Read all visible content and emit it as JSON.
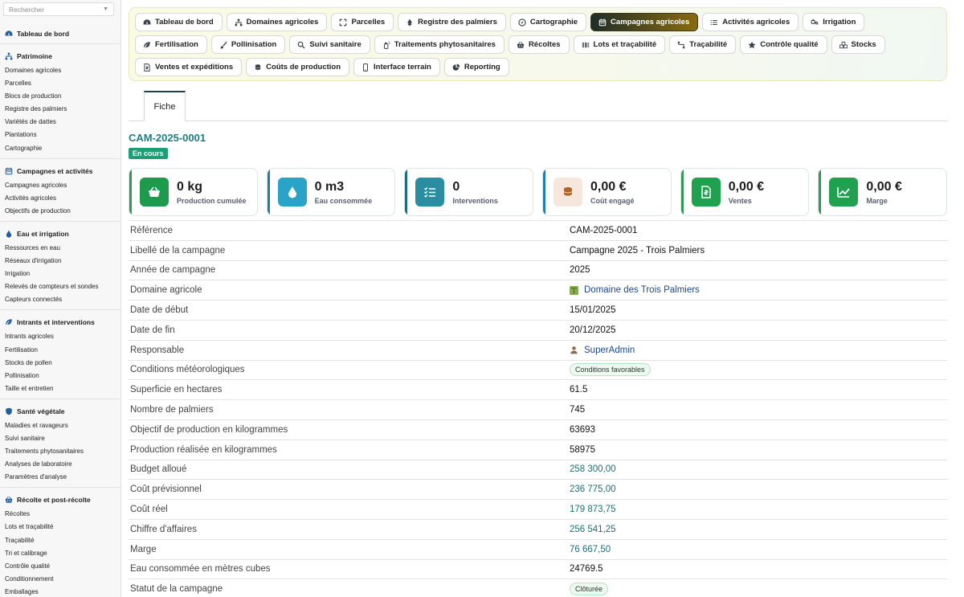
{
  "search": {
    "placeholder": "Rechercher"
  },
  "sidebar": {
    "dashboard_label": "Tableau de bord",
    "groups": [
      {
        "title": "Patrimoine",
        "icon": "sitemap-icon",
        "items": [
          "Domaines agricoles",
          "Parcelles",
          "Blocs de production",
          "Registre des palmiers",
          "Variétés de dattes",
          "Plantations",
          "Cartographie"
        ]
      },
      {
        "title": "Campagnes et activités",
        "icon": "calendar-icon",
        "items": [
          "Campagnes agricoles",
          "Activités agricoles",
          "Objectifs de production"
        ]
      },
      {
        "title": "Eau et irrigation",
        "icon": "droplet-icon",
        "items": [
          "Ressources en eau",
          "Réseaux d'irrigation",
          "Irrigation",
          "Relevés de compteurs et sondes",
          "Capteurs connectés"
        ]
      },
      {
        "title": "Intrants et interventions",
        "icon": "leaf-icon",
        "items": [
          "Intrants agricoles",
          "Fertilisation",
          "Stocks de pollen",
          "Pollinisation",
          "Taille et entretien"
        ]
      },
      {
        "title": "Santé végétale",
        "icon": "shield-icon",
        "items": [
          "Maladies et ravageurs",
          "Suivi sanitaire",
          "Traitements phytosanitaires",
          "Analyses de laboratoire",
          "Paramètres d'analyse"
        ]
      },
      {
        "title": "Récolte et post-récolte",
        "icon": "basket-icon",
        "items": [
          "Récoltes",
          "Lots et traçabilité",
          "Traçabilité",
          "Tri et calibrage",
          "Contrôle qualité",
          "Conditionnement",
          "Emballages"
        ]
      }
    ]
  },
  "nav": [
    {
      "label": "Tableau de bord",
      "icon": "dashboard-icon",
      "active": false
    },
    {
      "label": "Domaines agricoles",
      "icon": "sitemap-icon",
      "active": false
    },
    {
      "label": "Parcelles",
      "icon": "expand-icon",
      "active": false
    },
    {
      "label": "Registre des palmiers",
      "icon": "tree-icon",
      "active": false
    },
    {
      "label": "Cartographie",
      "icon": "compass-icon",
      "active": false
    },
    {
      "label": "Campagnes agricoles",
      "icon": "calendar-icon",
      "active": true
    },
    {
      "label": "Activités agricoles",
      "icon": "list-icon",
      "active": false
    },
    {
      "label": "Irrigation",
      "icon": "faucet-icon",
      "active": false
    },
    {
      "label": "Fertilisation",
      "icon": "leaf-icon",
      "active": false
    },
    {
      "label": "Pollinisation",
      "icon": "brush-icon",
      "active": false
    },
    {
      "label": "Suivi sanitaire",
      "icon": "search-icon",
      "active": false
    },
    {
      "label": "Traitements phytosanitaires",
      "icon": "spray-icon",
      "active": false
    },
    {
      "label": "Récoltes",
      "icon": "basket-icon",
      "active": false
    },
    {
      "label": "Lots et traçabilité",
      "icon": "barcode-icon",
      "active": false
    },
    {
      "label": "Traçabilité",
      "icon": "route-icon",
      "active": false
    },
    {
      "label": "Contrôle qualité",
      "icon": "star-icon",
      "active": false
    },
    {
      "label": "Stocks",
      "icon": "cubes-icon",
      "active": false
    },
    {
      "label": "Ventes et expéditions",
      "icon": "invoice-icon",
      "active": false
    },
    {
      "label": "Coûts de production",
      "icon": "coins-icon",
      "active": false
    },
    {
      "label": "Interface terrain",
      "icon": "mobile-icon",
      "active": false
    },
    {
      "label": "Reporting",
      "icon": "pie-chart-icon",
      "active": false
    }
  ],
  "tab": {
    "label": "Fiche"
  },
  "record": {
    "code": "CAM-2025-0001",
    "status": "En cours"
  },
  "kpis": [
    {
      "value": "0 kg",
      "label": "Production cumulée",
      "icon": "basket-icon",
      "color": "#1e9a4c",
      "bar": "#2e9a55",
      "fg": "#ffffff"
    },
    {
      "value": "0 m3",
      "label": "Eau consommée",
      "icon": "droplet-icon",
      "color": "#2aa3c9",
      "bar": "#1b7fa7",
      "fg": "#ffffff"
    },
    {
      "value": "0",
      "label": "Interventions",
      "icon": "checklist-icon",
      "color": "#2b8ea0",
      "bar": "#1b6e7e",
      "fg": "#ffffff"
    },
    {
      "value": "0,00 €",
      "label": "Coût engagé",
      "icon": "coins-icon",
      "color": "#f6e6dc",
      "bar": "#1b7fa7",
      "fg": "#b0642a"
    },
    {
      "value": "0,00 €",
      "label": "Ventes",
      "icon": "invoice-icon",
      "color": "#1fa150",
      "bar": "#2e9a55",
      "fg": "#ffffff"
    },
    {
      "value": "0,00 €",
      "label": "Marge",
      "icon": "chart-line-icon",
      "color": "#1fa150",
      "bar": "#2e9a55",
      "fg": "#ffffff"
    }
  ],
  "fields": [
    {
      "label": "Référence",
      "value": "CAM-2025-0001",
      "kind": "text"
    },
    {
      "label": "Libellé de la campagne",
      "value": "Campagne 2025 - Trois Palmiers",
      "kind": "text"
    },
    {
      "label": "Année de campagne",
      "value": "2025",
      "kind": "text"
    },
    {
      "label": "Domaine agricole",
      "value": "Domaine des Trois Palmiers",
      "kind": "link",
      "icon": "palm-icon"
    },
    {
      "label": "Date de début",
      "value": "15/01/2025",
      "kind": "text"
    },
    {
      "label": "Date de fin",
      "value": "20/12/2025",
      "kind": "text"
    },
    {
      "label": "Responsable",
      "value": "SuperAdmin",
      "kind": "link",
      "icon": "user-icon"
    },
    {
      "label": "Conditions météorologiques",
      "value": "Conditions favorables",
      "kind": "pill"
    },
    {
      "label": "Superficie en hectares",
      "value": "61.5",
      "kind": "text"
    },
    {
      "label": "Nombre de palmiers",
      "value": "745",
      "kind": "text"
    },
    {
      "label": "Objectif de production en kilogrammes",
      "value": "63693",
      "kind": "text"
    },
    {
      "label": "Production réalisée en kilogrammes",
      "value": "58975",
      "kind": "text"
    },
    {
      "label": "Budget alloué",
      "value": "258 300,00",
      "kind": "money"
    },
    {
      "label": "Coût prévisionnel",
      "value": "236 775,00",
      "kind": "money"
    },
    {
      "label": "Coût réel",
      "value": "179 873,75",
      "kind": "money"
    },
    {
      "label": "Chiffre d'affaires",
      "value": "256 541,25",
      "kind": "money"
    },
    {
      "label": "Marge",
      "value": "76 667,50",
      "kind": "money"
    },
    {
      "label": "Eau consommée en mètres cubes",
      "value": "24769.5",
      "kind": "text"
    },
    {
      "label": "Statut de la campagne",
      "value": "Clôturée",
      "kind": "pill"
    }
  ]
}
